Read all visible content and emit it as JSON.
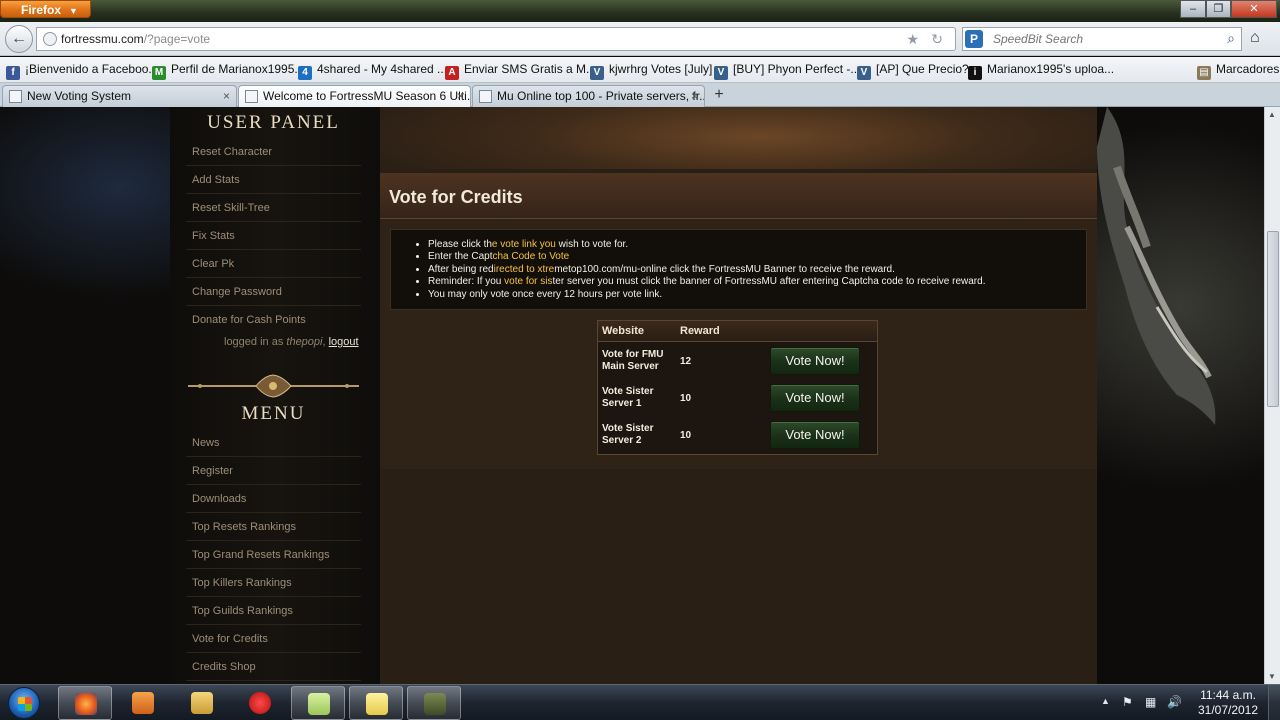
{
  "browser": {
    "menu_label": "Firefox",
    "url_domain": "fortressmu.com",
    "url_path": "/?page=vote",
    "search_placeholder": "SpeedBit Search",
    "bookmarks": [
      {
        "label": "¡Bienvenido a Faceboo...",
        "color": "#3b5998",
        "glyph": "f"
      },
      {
        "label": "Perfil de Marianox1995...",
        "color": "#2c8b2c",
        "glyph": "M"
      },
      {
        "label": "4shared - My 4shared ...",
        "color": "#1e6fc2",
        "glyph": "4"
      },
      {
        "label": "Enviar SMS Gratis a M...",
        "color": "#c42020",
        "glyph": "A"
      },
      {
        "label": "kjwrhrg Votes [July]",
        "color": "#3a5f8a",
        "glyph": "V"
      },
      {
        "label": "[BUY] Phyon Perfect -...",
        "color": "#3a5f8a",
        "glyph": "V"
      },
      {
        "label": "[AP] Que Precio?",
        "color": "#3a5f8a",
        "glyph": "V"
      },
      {
        "label": "Marianox1995's uploa...",
        "color": "#111111",
        "glyph": "i"
      }
    ],
    "bookmarks_menu": "Marcadores",
    "tabs": [
      {
        "label": "New Voting System"
      },
      {
        "label": "Welcome to FortressMU Season 6 Ulti..."
      },
      {
        "label": "Mu Online top 100 - Private servers, fr..."
      }
    ]
  },
  "sidebar": {
    "panel_title": "USER PANEL",
    "user_items": [
      "Reset Character",
      "Add Stats",
      "Reset Skill-Tree",
      "Fix Stats",
      "Clear Pk",
      "Change Password",
      "Donate for Cash Points"
    ],
    "logged_in_prefix": "logged in as",
    "username": "thepopi",
    "logout_label": "logout",
    "menu_title": "MENU",
    "menu_items": [
      "News",
      "Register",
      "Downloads",
      "Top Resets Rankings",
      "Top Grand Resets Rankings",
      "Top Killers Rankings",
      "Top Guilds Rankings",
      "Vote for Credits",
      "Credits Shop"
    ]
  },
  "main": {
    "title": "Vote for Credits",
    "instructions": {
      "i1_a": "Please click th",
      "i1_b": "e vote link you",
      "i1_c": " wish to vote for.",
      "i2_a": "Enter the Capt",
      "i2_b": "cha Code to Vote",
      "i3_a": "After being red",
      "i3_b": "irected to xtre",
      "i3_c": "metop100.com/mu-online click the FortressMU Banner to receive the reward.",
      "i4_a": "Reminder: If you ",
      "i4_b": "vote for sis",
      "i4_c": "ter server you must click the banner of FortressMU after entering Captcha code to receive reward.",
      "i5": "You may only vote once every 12 hours per vote link."
    },
    "table": {
      "col_website": "Website",
      "col_reward": "Reward",
      "rows": [
        {
          "website": "Vote for FMU Main Server",
          "reward": "12",
          "button": "Vote Now!"
        },
        {
          "website": "Vote Sister Server 1",
          "reward": "10",
          "button": "Vote Now!"
        },
        {
          "website": "Vote Sister Server 2",
          "reward": "10",
          "button": "Vote Now!"
        }
      ]
    }
  },
  "taskbar": {
    "time": "11:44 a.m.",
    "date": "31/07/2012"
  }
}
